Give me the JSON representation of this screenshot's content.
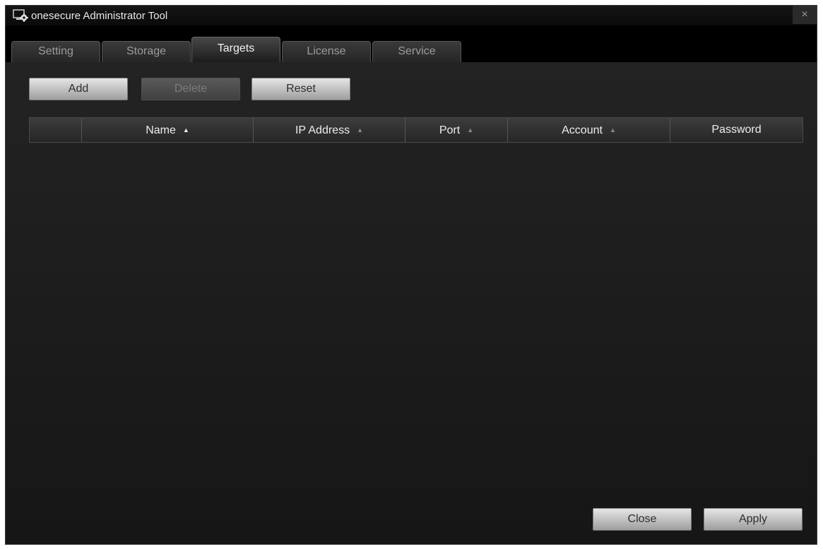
{
  "window": {
    "title": "onesecure Administrator Tool",
    "close_glyph": "×"
  },
  "tabs": [
    {
      "label": "Setting",
      "active": false
    },
    {
      "label": "Storage",
      "active": false
    },
    {
      "label": "Targets",
      "active": true
    },
    {
      "label": "License",
      "active": false
    },
    {
      "label": "Service",
      "active": false
    }
  ],
  "toolbar": {
    "add_label": "Add",
    "delete_label": "Delete",
    "reset_label": "Reset",
    "delete_disabled": true
  },
  "table": {
    "columns": [
      {
        "label": "Name",
        "sort_indicator": "▲",
        "sort_active": true
      },
      {
        "label": "IP Address",
        "sort_indicator": "▲",
        "sort_active": false
      },
      {
        "label": "Port",
        "sort_indicator": "▲",
        "sort_active": false
      },
      {
        "label": "Account",
        "sort_indicator": "▲",
        "sort_active": false
      },
      {
        "label": "Password",
        "sort_indicator": "",
        "sort_active": false
      }
    ],
    "rows": []
  },
  "footer": {
    "close_label": "Close",
    "apply_label": "Apply"
  },
  "icons": {
    "app": "monitor-gear-icon",
    "sort": "sort-up-arrow-icon",
    "close": "close-icon"
  },
  "colors": {
    "background": "#1c1c1c",
    "titlebar": "#0a0a0a",
    "button_face": "#c8c8c8"
  }
}
